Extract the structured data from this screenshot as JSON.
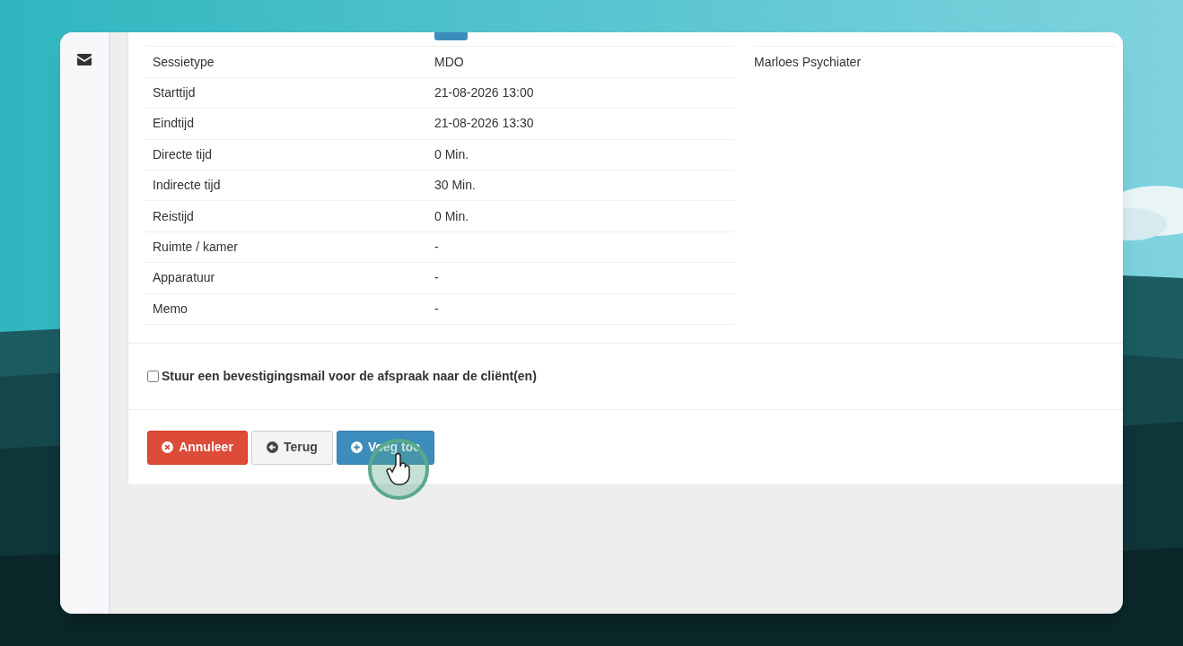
{
  "details": [
    {
      "kind": "badge"
    },
    {
      "label": "Sessietype",
      "value": "MDO",
      "kind": "text"
    },
    {
      "label": "Starttijd",
      "value": "21-08-2026 13:00",
      "kind": "text"
    },
    {
      "label": "Eindtijd",
      "value": "21-08-2026 13:30",
      "kind": "text"
    },
    {
      "label": "Directe tijd",
      "value": "0 Min.",
      "kind": "text"
    },
    {
      "label": "Indirecte tijd",
      "value": "30 Min.",
      "kind": "text"
    },
    {
      "label": "Reistijd",
      "value": "0 Min.",
      "kind": "text"
    },
    {
      "label": "Ruimte / kamer",
      "value": "-",
      "kind": "text"
    },
    {
      "label": "Apparatuur",
      "value": "-",
      "kind": "text"
    },
    {
      "label": "Memo",
      "value": "-",
      "kind": "text"
    }
  ],
  "participants": [
    {
      "name": "Marloes Psychiater"
    }
  ],
  "confirmation": {
    "label": "Stuur een bevestigingsmail voor de afspraak naar de cliënt(en)",
    "checked": false
  },
  "buttons": [
    {
      "label": "Annuleer",
      "kind": "danger"
    },
    {
      "label": "Terug",
      "kind": "back"
    },
    {
      "label": "Voeg toe",
      "kind": "primary"
    }
  ]
}
